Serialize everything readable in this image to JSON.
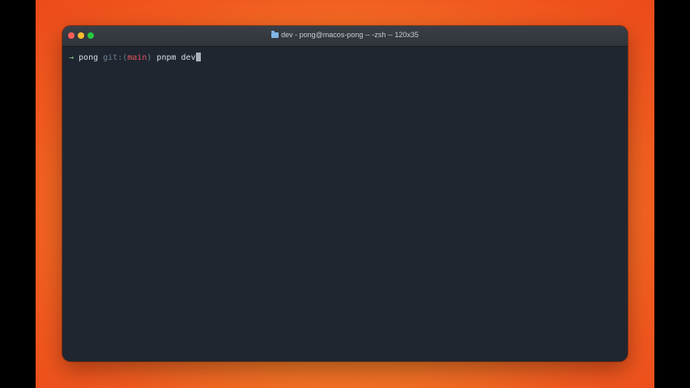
{
  "window": {
    "title": "dev - pong@macos-pong -- -zsh -- 120x35",
    "folder_icon": "folder-icon"
  },
  "terminal": {
    "prompt_arrow": "→",
    "directory": "pong",
    "git_label": "git:(",
    "branch": "main",
    "git_close": ")",
    "command": "pnpm dev"
  },
  "colors": {
    "background_gradient": [
      "#f9a23a",
      "#ec4a1a"
    ],
    "terminal_bg": "#1f2630",
    "branch": "#e5575a",
    "prompt_arrow": "#8fd18b"
  }
}
